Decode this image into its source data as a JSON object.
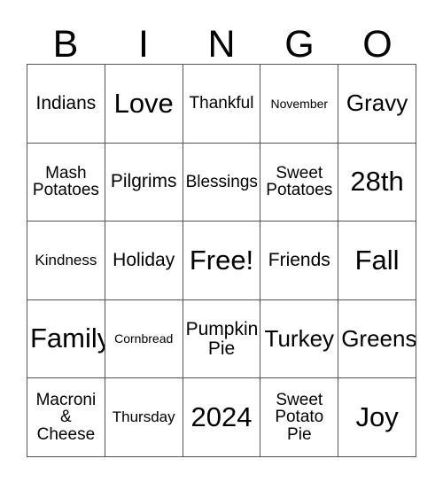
{
  "header": {
    "letters": [
      "B",
      "I",
      "N",
      "G",
      "O"
    ]
  },
  "grid": {
    "rows": 5,
    "columns": 5,
    "border_color": "#555555",
    "background_color": "#ffffff",
    "text_color": "#000000",
    "cells": [
      {
        "text": "Indians",
        "size": "lg"
      },
      {
        "text": "Love",
        "size": "xxl"
      },
      {
        "text": "Thankful",
        "size": "md"
      },
      {
        "text": "November",
        "size": "xs"
      },
      {
        "text": "Gravy",
        "size": "xl"
      },
      {
        "text": "Mash\nPotatoes",
        "size": "md"
      },
      {
        "text": "Pilgrims",
        "size": "lg"
      },
      {
        "text": "Blessings",
        "size": "md"
      },
      {
        "text": "Sweet\nPotatoes",
        "size": "md"
      },
      {
        "text": "28th",
        "size": "xxl"
      },
      {
        "text": "Kindness",
        "size": "sm"
      },
      {
        "text": "Holiday",
        "size": "lg"
      },
      {
        "text": "Free!",
        "size": "xxl"
      },
      {
        "text": "Friends",
        "size": "lg"
      },
      {
        "text": "Fall",
        "size": "xxl"
      },
      {
        "text": "Family",
        "size": "xxl"
      },
      {
        "text": "Cornbread",
        "size": "xs"
      },
      {
        "text": "Pumpkin\nPie",
        "size": "lg"
      },
      {
        "text": "Turkey",
        "size": "xl"
      },
      {
        "text": "Greens",
        "size": "xl"
      },
      {
        "text": "Macroni\n&\nCheese",
        "size": "md"
      },
      {
        "text": "Thursday",
        "size": "sm"
      },
      {
        "text": "2024",
        "size": "xxl"
      },
      {
        "text": "Sweet\nPotato\nPie",
        "size": "md"
      },
      {
        "text": "Joy",
        "size": "xxl"
      }
    ]
  }
}
